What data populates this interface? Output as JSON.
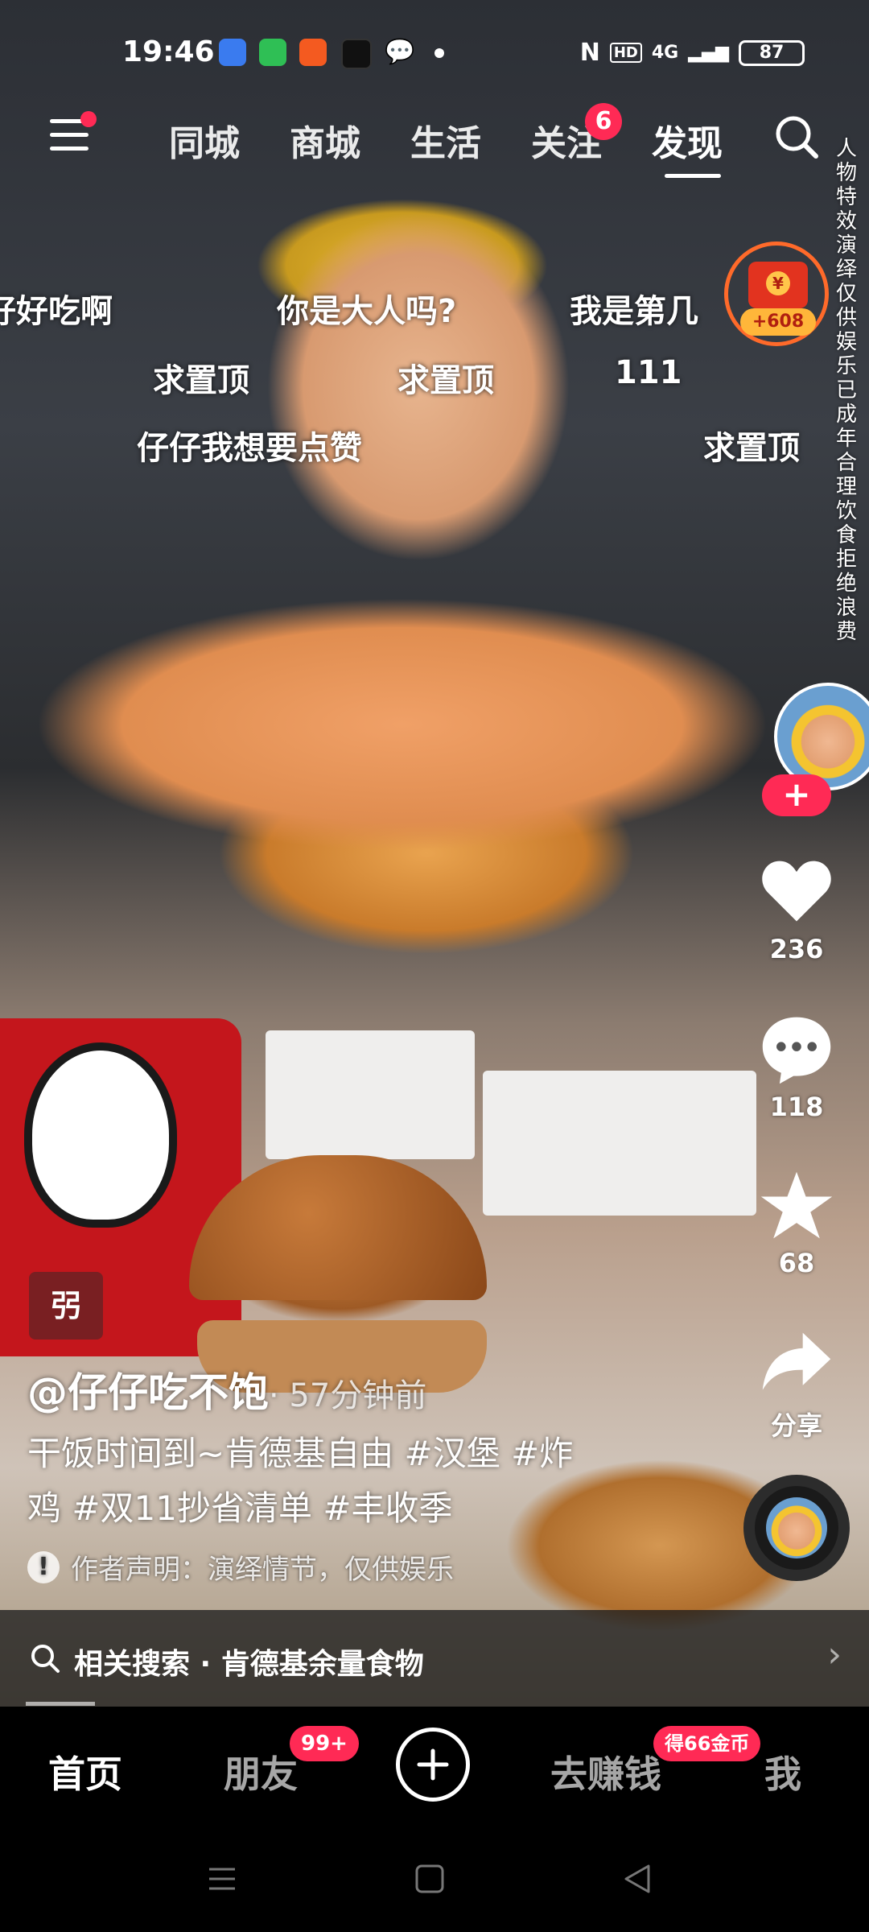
{
  "status_bar": {
    "time": "19:46",
    "network": "4G",
    "battery": "87"
  },
  "top_nav": {
    "tabs": [
      "同城",
      "商城",
      "生活",
      "关注",
      "发现"
    ],
    "active_tab": "发现",
    "follow_badge": "6"
  },
  "danmaku": [
    "好好吃啊",
    "你是大人吗?",
    "我是第几",
    "求置顶",
    "求置顶",
    "111",
    "仔仔我想要点赞",
    "求置顶"
  ],
  "vertical_notice": "人物特效演绎仅供娱乐已成年合理饮食拒绝浪费",
  "red_packet": {
    "amount": "+608"
  },
  "actions": {
    "like_count": "236",
    "comment_count": "118",
    "favorite_count": "68",
    "share_label": "分享"
  },
  "video_info": {
    "tag_label": "弜",
    "author": "@仔仔吃不饱",
    "time_ago": "· 57分钟前",
    "caption": "干饭时间到~肯德基自由 #汉堡 #炸鸡 #双11抄省清单 #丰收季",
    "notice": "作者声明：演绎情节，仅供娱乐"
  },
  "related_search": {
    "label": "相关搜索 · 肯德基余量食物"
  },
  "bottom_nav": {
    "home": "首页",
    "friends": "朋友",
    "friends_badge": "99+",
    "earn": "去赚钱",
    "earn_badge": "得66金币",
    "me": "我"
  }
}
